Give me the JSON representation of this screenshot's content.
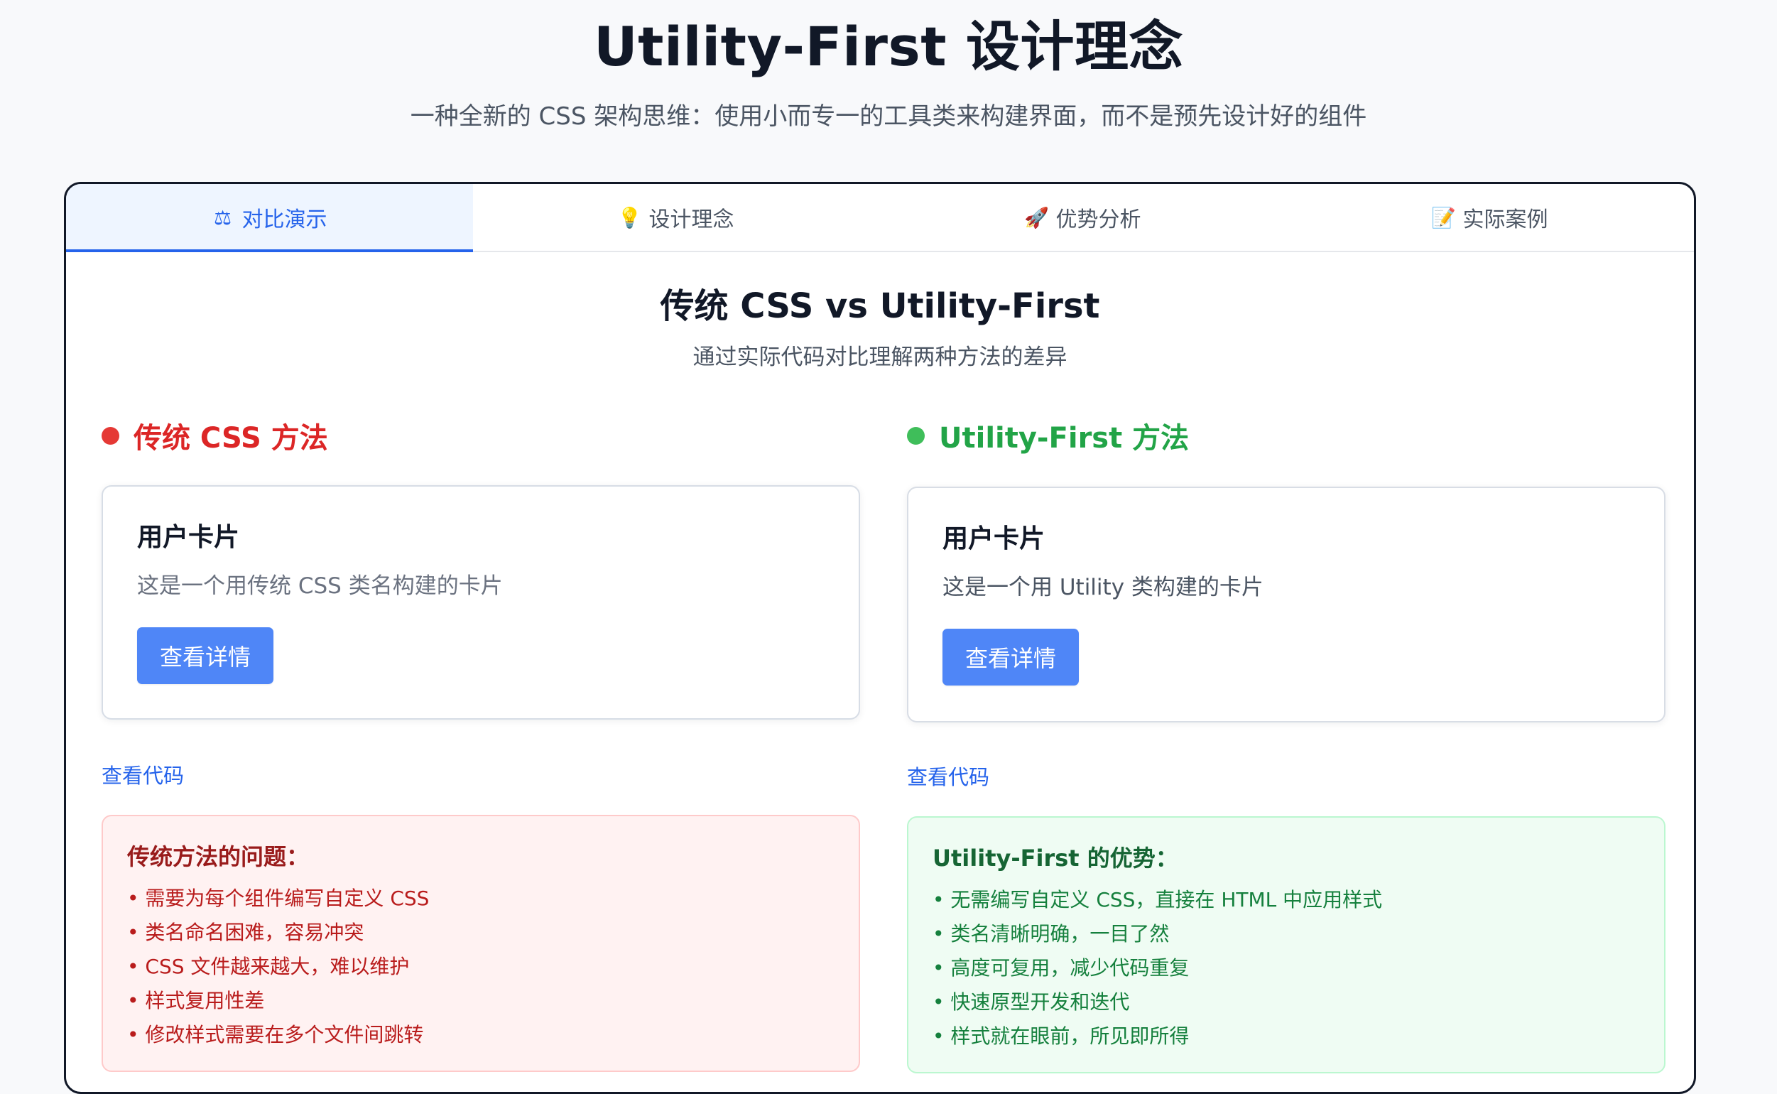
{
  "header": {
    "title": "Utility-First 设计理念",
    "subtitle": "一种全新的 CSS 架构思维：使用小而专一的工具类来构建界面，而不是预先设计好的组件"
  },
  "tabs": [
    {
      "label": "对比演示",
      "icon": "⚖"
    },
    {
      "label": "设计理念",
      "icon": "💡"
    },
    {
      "label": "优势分析",
      "icon": "🚀"
    },
    {
      "label": "实际案例",
      "icon": "📝"
    }
  ],
  "section": {
    "title": "传统 CSS vs Utility-First",
    "subtitle": "通过实际代码对比理解两种方法的差异"
  },
  "traditional": {
    "heading": "传统 CSS 方法",
    "color": "#dc2626",
    "card_title": "用户卡片",
    "card_text": "这是一个用传统 CSS 类名构建的卡片",
    "button_label": "查看详情",
    "code_link": "查看代码",
    "problem_title": "传统方法的问题：",
    "items": [
      "• 需要为每个组件编写自定义 CSS",
      "• 类名命名困难，容易冲突",
      "• CSS 文件越来越大，难以维护",
      "• 样式复用性差",
      "• 修改样式需要在多个文件间跳转"
    ]
  },
  "utility": {
    "heading": "Utility-First 方法",
    "color": "#16a34a",
    "card_title": "用户卡片",
    "card_text": "这是一个用 Utility 类构建的卡片",
    "button_label": "查看详情",
    "code_link": "查看代码",
    "advantage_title": "Utility-First 的优势：",
    "items": [
      "• 无需编写自定义 CSS，直接在 HTML 中应用样式",
      "• 类名清晰明确，一目了然",
      "• 高度可复用，减少代码重复",
      "• 快速原型开发和迭代",
      "• 样式就在眼前，所见即所得"
    ]
  }
}
